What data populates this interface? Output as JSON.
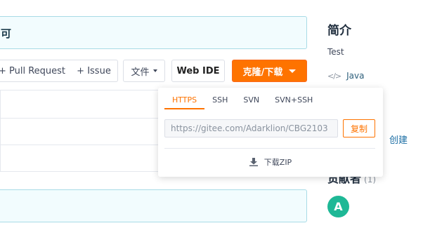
{
  "hints": {
    "top_fragment": "可",
    "bottom_fragment": ""
  },
  "toolbar": {
    "pull_request_label": "+ Pull Request",
    "issue_label": "+ Issue",
    "file_label": "文件",
    "web_ide_label": "Web IDE",
    "clone_label": "克隆/下载"
  },
  "sidebar": {
    "title": "简介",
    "description": "Test",
    "language_icon": "</>",
    "language": "Java",
    "create_text": "创建",
    "contributors_title": "贡献者",
    "contributors_count": "(1)",
    "avatar_letter": "A"
  },
  "clone_panel": {
    "tabs": [
      {
        "label": "HTTPS",
        "active": true
      },
      {
        "label": "SSH",
        "active": false
      },
      {
        "label": "SVN",
        "active": false
      },
      {
        "label": "SVN+SSH",
        "active": false
      }
    ],
    "url": "https://gitee.com/Adarklion/CBG2103",
    "copy_label": "复制",
    "download_label": "下载ZIP"
  },
  "colors": {
    "accent": "#fe7300",
    "hint_bg": "#f2fcfe",
    "hint_border": "#a8dbe6",
    "avatar_bg": "#1eb896"
  },
  "icons": {
    "language": "code-icon",
    "download": "download-icon",
    "dropdown": "chevron-down-icon"
  }
}
